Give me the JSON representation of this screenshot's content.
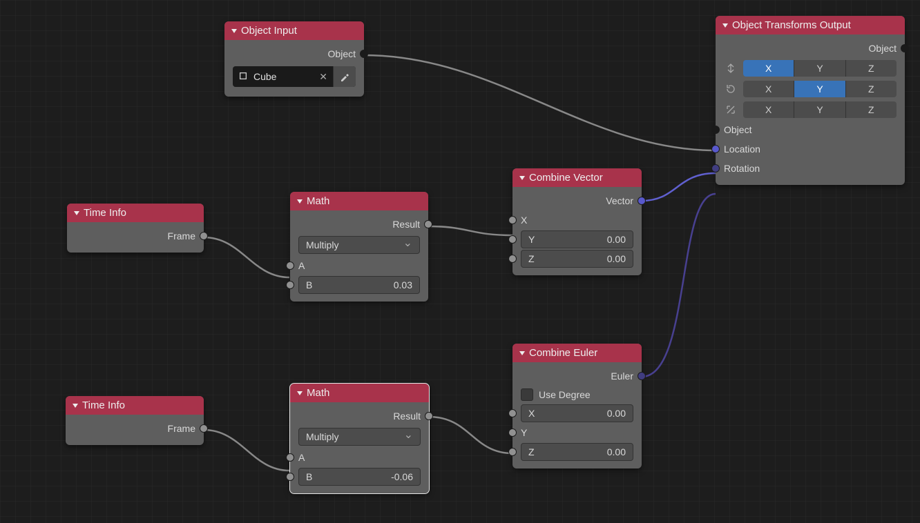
{
  "nodes": {
    "object_input": {
      "title": "Object Input",
      "output": "Object",
      "object_value": "Cube"
    },
    "time_info_1": {
      "title": "Time Info",
      "output": "Frame"
    },
    "time_info_2": {
      "title": "Time Info",
      "output": "Frame"
    },
    "math_1": {
      "title": "Math",
      "output": "Result",
      "operation": "Multiply",
      "input_a": "A",
      "input_b_label": "B",
      "input_b_value": "0.03"
    },
    "math_2": {
      "title": "Math",
      "output": "Result",
      "operation": "Multiply",
      "input_a": "A",
      "input_b_label": "B",
      "input_b_value": "-0.06"
    },
    "combine_vector": {
      "title": "Combine Vector",
      "output": "Vector",
      "x_label": "X",
      "y_label": "Y",
      "y_value": "0.00",
      "z_label": "Z",
      "z_value": "0.00"
    },
    "combine_euler": {
      "title": "Combine Euler",
      "output": "Euler",
      "use_degree": "Use Degree",
      "x_label": "X",
      "x_value": "0.00",
      "y_label": "Y",
      "z_label": "Z",
      "z_value": "0.00"
    },
    "object_transforms": {
      "title": "Object Transforms Output",
      "output": "Object",
      "axes": {
        "x": "X",
        "y": "Y",
        "z": "Z"
      },
      "loc_active": "X",
      "rot_active": "Y",
      "scale_active": "",
      "inputs": {
        "object": "Object",
        "location": "Location",
        "rotation": "Rotation"
      }
    }
  }
}
